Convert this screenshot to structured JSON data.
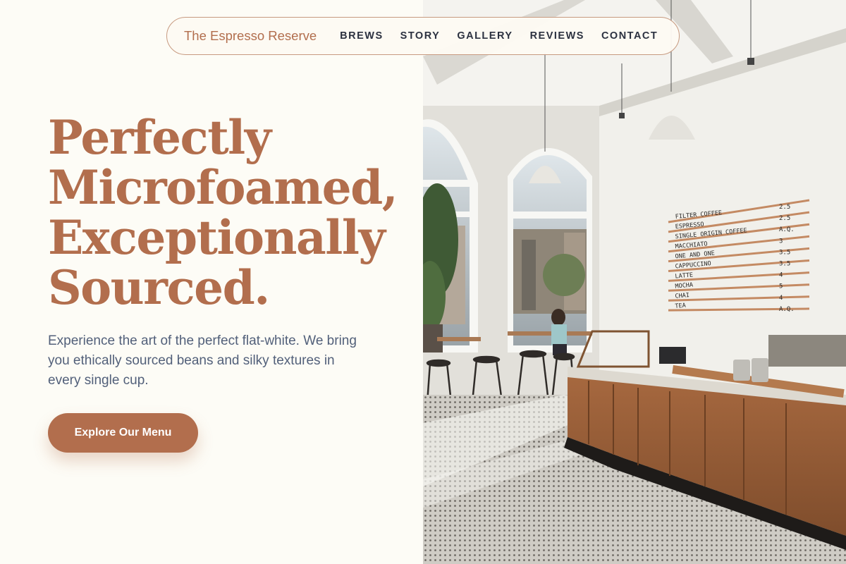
{
  "brand": {
    "name": "The Espresso Reserve"
  },
  "nav": {
    "links": [
      "BREWS",
      "STORY",
      "GALLERY",
      "REVIEWS",
      "CONTACT"
    ]
  },
  "hero": {
    "headline": [
      "Perfectly",
      "Microfoamed,",
      "Exceptionally",
      "Sourced."
    ],
    "subtext": "Experience the art of the perfect flat-white. We bring you ethically sourced beans and silky textures in every single cup.",
    "cta_label": "Explore Our Menu"
  },
  "photo": {
    "menu_board": [
      {
        "item": "FILTER COFFEE",
        "price": "2.5"
      },
      {
        "item": "ESPRESSO",
        "price": "2.5"
      },
      {
        "item": "SINGLE ORIGIN COFFEE",
        "price": "A.Q."
      },
      {
        "item": "MACCHIATO",
        "price": "3"
      },
      {
        "item": "ONE AND ONE",
        "price": "3.5"
      },
      {
        "item": "CAPPUCCINO",
        "price": "3.5"
      },
      {
        "item": "LATTE",
        "price": "4"
      },
      {
        "item": "MOCHA",
        "price": "5"
      },
      {
        "item": "CHAI",
        "price": "4"
      },
      {
        "item": "TEA",
        "price": "A.Q."
      }
    ]
  },
  "colors": {
    "accent": "#b26e4d",
    "background": "#fdfcf6",
    "body_text": "#52607a",
    "nav_text": "#2b3140"
  }
}
